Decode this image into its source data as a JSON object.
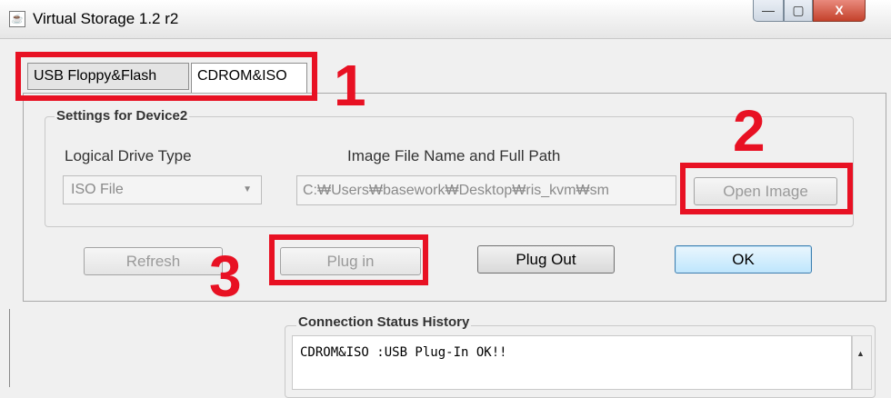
{
  "window": {
    "title": "Virtual Storage 1.2 r2",
    "minimize": "—",
    "maximize": "▢",
    "close": "X"
  },
  "tabs": [
    {
      "label": "USB Floppy&Flash"
    },
    {
      "label": "CDROM&ISO",
      "selected": true
    }
  ],
  "settings": {
    "legend": "Settings for Device2",
    "drive_type_label": "Logical Drive Type",
    "drive_type_value": "ISO File",
    "image_path_label": "Image File Name and Full Path",
    "image_path_value": "C:₩Users₩basework₩Desktop₩ris_kvm₩sm",
    "open_image_label": "Open Image"
  },
  "actions": {
    "refresh_label": "Refresh",
    "plugin_label": "Plug in",
    "plugout_label": "Plug Out",
    "ok_label": "OK"
  },
  "status": {
    "legend": "Connection Status History",
    "log": "CDROM&ISO :USB Plug-In OK!!"
  },
  "annotations": {
    "n1": "1",
    "n2": "2",
    "n3": "3",
    "color": "#e81123"
  }
}
